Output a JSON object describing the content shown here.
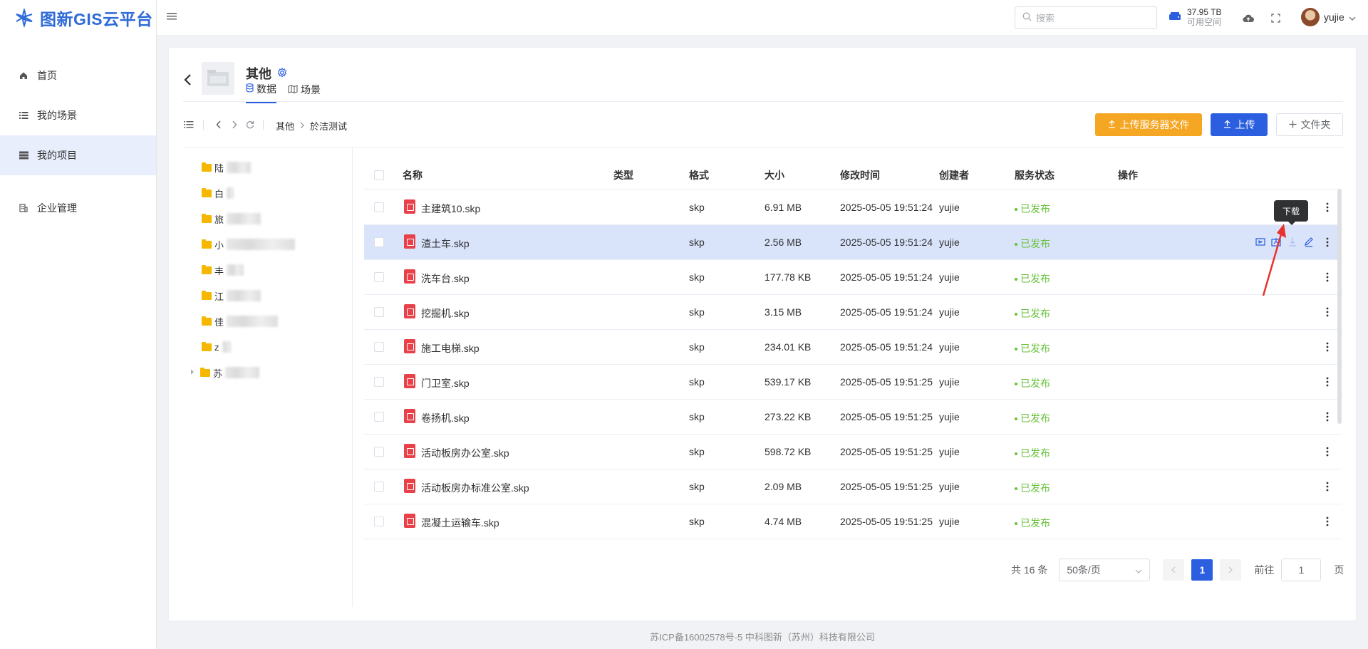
{
  "app": {
    "logo_text": "图新GIS云平台"
  },
  "sidebar": {
    "items": [
      {
        "label": "首页",
        "icon": "home-icon",
        "active": false
      },
      {
        "label": "我的场景",
        "icon": "list-icon",
        "active": false
      },
      {
        "label": "我的项目",
        "icon": "project-icon",
        "active": true
      },
      {
        "label": "企业管理",
        "icon": "building-icon",
        "active": false
      }
    ]
  },
  "topbar": {
    "search_placeholder": "搜索",
    "storage_size": "37.95 TB",
    "storage_label": "可用空间",
    "user_name": "yujie"
  },
  "project": {
    "title": "其他",
    "tabs": [
      {
        "label": "数据",
        "active": true
      },
      {
        "label": "场景",
        "active": false
      }
    ]
  },
  "breadcrumb": [
    "其他",
    "於洁测试"
  ],
  "buttons": {
    "upload_server": "上传服务器文件",
    "upload": "上传",
    "folder": "文件夹"
  },
  "tree": {
    "items": [
      {
        "label": "陆"
      },
      {
        "label": "白"
      },
      {
        "label": "旅"
      },
      {
        "label": "小"
      },
      {
        "label": "丰"
      },
      {
        "label": "江"
      },
      {
        "label": "佳"
      },
      {
        "label": "z"
      },
      {
        "label": "苏",
        "expandable": true
      }
    ]
  },
  "table": {
    "columns": [
      "名称",
      "类型",
      "格式",
      "大小",
      "修改时间",
      "创建者",
      "服务状态",
      "操作"
    ],
    "rows": [
      {
        "name": "主建筑10.skp",
        "type": "",
        "format": "skp",
        "size": "6.91 MB",
        "modified": "2025-05-05 19:51:24",
        "creator": "yujie",
        "status": "已发布"
      },
      {
        "name": "渣土车.skp",
        "type": "",
        "format": "skp",
        "size": "2.56 MB",
        "modified": "2025-05-05 19:51:24",
        "creator": "yujie",
        "status": "已发布"
      },
      {
        "name": "洗车台.skp",
        "type": "",
        "format": "skp",
        "size": "177.78 KB",
        "modified": "2025-05-05 19:51:24",
        "creator": "yujie",
        "status": "已发布"
      },
      {
        "name": "挖掘机.skp",
        "type": "",
        "format": "skp",
        "size": "3.15 MB",
        "modified": "2025-05-05 19:51:24",
        "creator": "yujie",
        "status": "已发布"
      },
      {
        "name": "施工电梯.skp",
        "type": "",
        "format": "skp",
        "size": "234.01 KB",
        "modified": "2025-05-05 19:51:24",
        "creator": "yujie",
        "status": "已发布"
      },
      {
        "name": "门卫室.skp",
        "type": "",
        "format": "skp",
        "size": "539.17 KB",
        "modified": "2025-05-05 19:51:25",
        "creator": "yujie",
        "status": "已发布"
      },
      {
        "name": "卷扬机.skp",
        "type": "",
        "format": "skp",
        "size": "273.22 KB",
        "modified": "2025-05-05 19:51:25",
        "creator": "yujie",
        "status": "已发布"
      },
      {
        "name": "活动板房办公室.skp",
        "type": "",
        "format": "skp",
        "size": "598.72 KB",
        "modified": "2025-05-05 19:51:25",
        "creator": "yujie",
        "status": "已发布"
      },
      {
        "name": "活动板房办标准公室.skp",
        "type": "",
        "format": "skp",
        "size": "2.09 MB",
        "modified": "2025-05-05 19:51:25",
        "creator": "yujie",
        "status": "已发布"
      },
      {
        "name": "混凝土运输车.skp",
        "type": "",
        "format": "skp",
        "size": "4.74 MB",
        "modified": "2025-05-05 19:51:25",
        "creator": "yujie",
        "status": "已发布"
      }
    ]
  },
  "tooltip": "下载",
  "pagination": {
    "total": "共 16 条",
    "page_size": "50条/页",
    "current": "1",
    "goto_label": "前往",
    "goto_value": "1",
    "page_suffix": "页"
  },
  "footer": "苏ICP备16002578号-5 中科图新（苏州）科技有限公司",
  "colors": {
    "primary": "#2b5fe0",
    "orange": "#f5a623",
    "published": "#67c23a",
    "highlight_row": "#d9e3fa"
  }
}
